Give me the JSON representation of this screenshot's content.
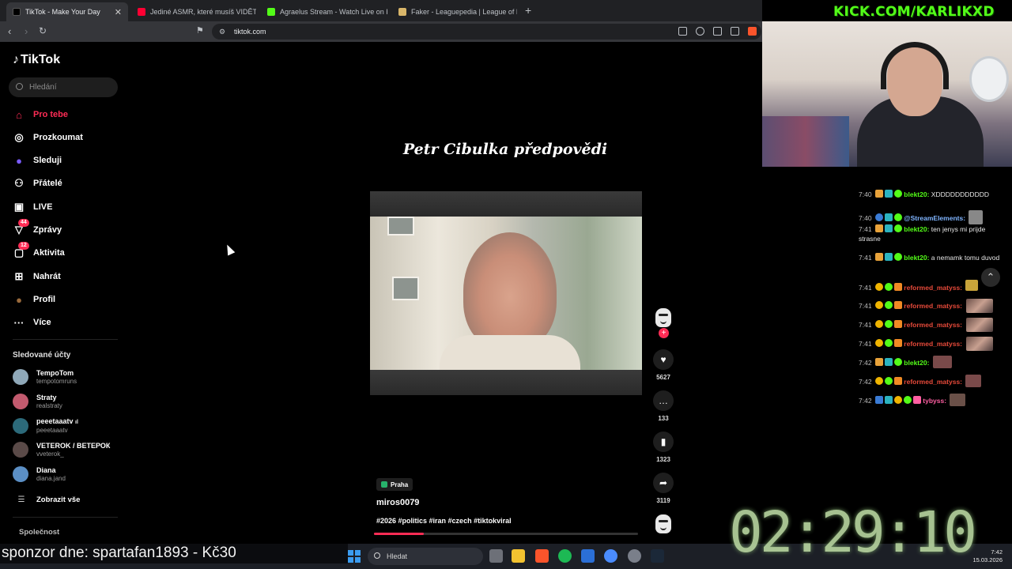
{
  "browser": {
    "tabs": [
      {
        "label": "TikTok - Make Your Day",
        "close": "✕"
      },
      {
        "label": "Jediné ASMR, které musíš VIDĚT! - Yo"
      },
      {
        "label": "Agraelus Stream - Watch Live on Kick"
      },
      {
        "label": "Faker - Leaguepedia | League of Lege"
      }
    ],
    "new_tab": "+",
    "url": "tiktok.com"
  },
  "sidebar": {
    "logo": "TikTok",
    "search_placeholder": "Hledání",
    "menu": [
      {
        "label": "Pro tebe",
        "icon": "⌂"
      },
      {
        "label": "Prozkoumat",
        "icon": "◎"
      },
      {
        "label": "Sleduji",
        "icon": "●"
      },
      {
        "label": "Přátelé",
        "icon": "⚇"
      },
      {
        "label": "LIVE",
        "icon": "▣"
      },
      {
        "label": "Zprávy",
        "icon": "▽",
        "badge": "44"
      },
      {
        "label": "Aktivita",
        "icon": "▢",
        "badge": "12"
      },
      {
        "label": "Nahrát",
        "icon": "⊞"
      },
      {
        "label": "Profil",
        "icon": "●"
      },
      {
        "label": "Více",
        "icon": "···"
      }
    ],
    "followed_title": "Sledované účty",
    "accounts": [
      {
        "name": "TempoTom",
        "handle": "tempotomruns",
        "color": "#8fa8b8"
      },
      {
        "name": "Straty",
        "handle": "realstraty",
        "color": "#c25a6e"
      },
      {
        "name": "peeetaaatv",
        "badge": "ıl",
        "handle": "peeetaaatv",
        "color": "#2c6a7a"
      },
      {
        "name": "VETEROK / ВЕТЕРОК",
        "handle": "vveterok_",
        "color": "#5a4a48"
      },
      {
        "name": "Diana",
        "handle": "diana.jand",
        "color": "#5b8fc5"
      }
    ],
    "show_all": "Zobrazit vše",
    "show_all_icon": "☰",
    "footer_title": "Společnost"
  },
  "feed": {
    "headline": "Petr Cibulka předpovědi",
    "location": "Praha",
    "author": "miros0079",
    "tags": "#2026 #politics #iran #czech #tiktokviral",
    "progress": 0.19,
    "actions": [
      {
        "name": "like",
        "icon": "♥",
        "count": "5627"
      },
      {
        "name": "comment",
        "icon": "…",
        "count": "133"
      },
      {
        "name": "save",
        "icon": "▮",
        "count": "1323"
      },
      {
        "name": "share",
        "icon": "➦",
        "count": "3119"
      }
    ],
    "follow_plus": "+"
  },
  "stream": {
    "channel": "KICK.COM/KARLIKXD",
    "timer": "02:29:10",
    "sponsor": "sponzor dne: spartafan1893 - Kč30",
    "scroll_up": "⌃",
    "chat": [
      {
        "time": "7:40",
        "user": "blekt20:",
        "color": "#53fc18",
        "text": "XDDDDDDDDDDD"
      },
      {
        "time": "7:40",
        "user": "@StreamElements:",
        "color": "#7fb4ff",
        "text": ""
      },
      {
        "time": "7:41",
        "user": "blekt20:",
        "color": "#53fc18",
        "text": "ten jenys mi prijde strasne"
      },
      {
        "time": "7:41",
        "user": "blekt20:",
        "color": "#53fc18",
        "text": "a nemamk tomu duvod"
      },
      {
        "time": "7:41",
        "user": "reformed_matyss:",
        "color": "#e84a3a",
        "text": ""
      },
      {
        "time": "7:41",
        "user": "reformed_matyss:",
        "color": "#e84a3a",
        "text": ""
      },
      {
        "time": "7:41",
        "user": "reformed_matyss:",
        "color": "#e84a3a",
        "text": ""
      },
      {
        "time": "7:41",
        "user": "reformed_matyss:",
        "color": "#e84a3a",
        "text": ""
      },
      {
        "time": "7:42",
        "user": "blekt20:",
        "color": "#53fc18",
        "text": ""
      },
      {
        "time": "7:42",
        "user": "reformed_matyss:",
        "color": "#e84a3a",
        "text": ""
      },
      {
        "time": "7:42",
        "user": "tybyss:",
        "color": "#ff5fa2",
        "text": ""
      }
    ]
  },
  "taskbar": {
    "search": "Hledat",
    "time": "7:42",
    "date": "15.03.2026"
  },
  "colors": {
    "accent": "#fe2c55",
    "kick_green": "#53fc18"
  }
}
